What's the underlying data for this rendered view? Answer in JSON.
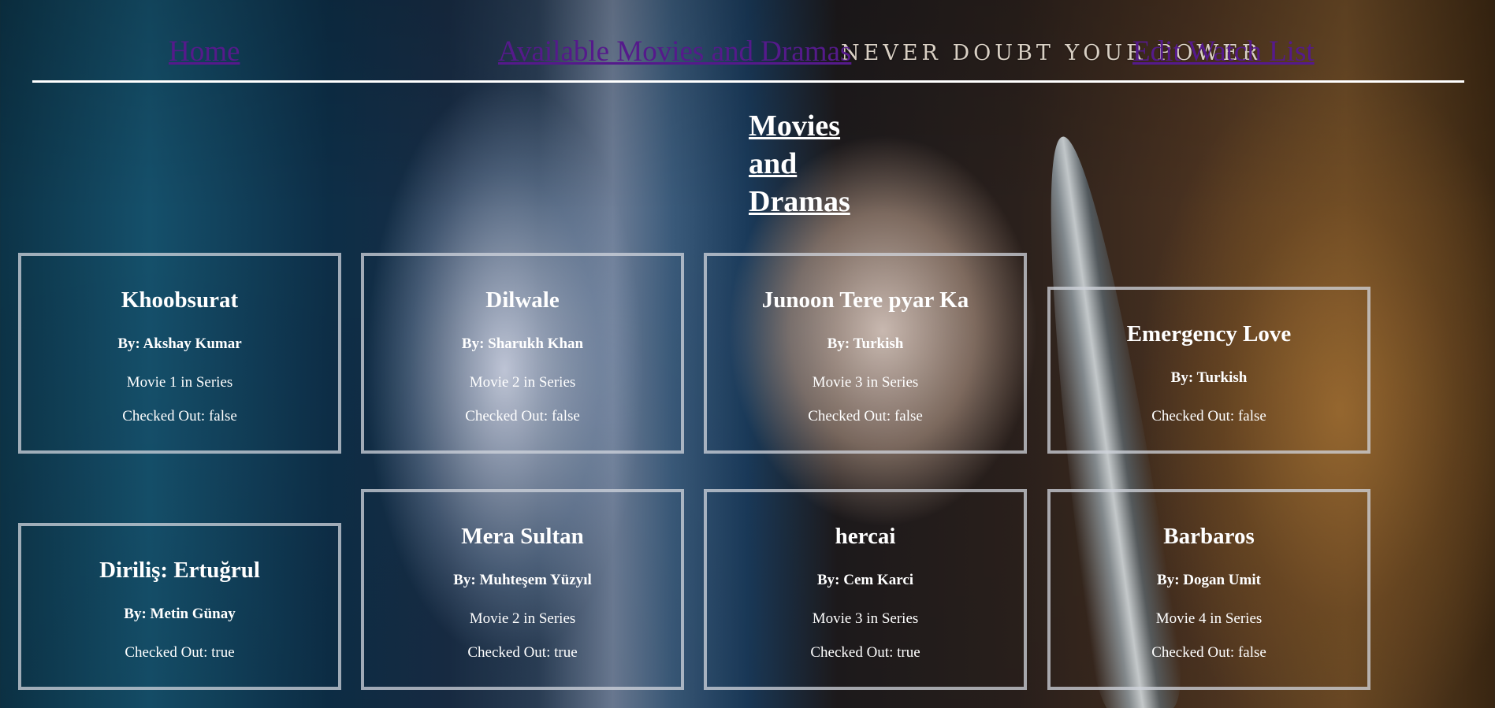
{
  "background": {
    "tagline": "NEVER DOUBT YOUR POWER"
  },
  "nav": {
    "home": "Home",
    "available": "Available Movies and Dramas",
    "edit": "Edit Watch List",
    "link_color": "#551a8b"
  },
  "page_title": "Movies and Dramas",
  "cards": [
    {
      "title": "Khoobsurat",
      "author": "By: Akshay Kumar",
      "series": "Movie 1 in Series",
      "checked_out": "Checked Out: false"
    },
    {
      "title": "Dilwale",
      "author": "By: Sharukh Khan",
      "series": "Movie 2 in Series",
      "checked_out": "Checked Out: false"
    },
    {
      "title": "Junoon Tere pyar Ka",
      "author": "By: Turkish",
      "series": "Movie 3 in Series",
      "checked_out": "Checked Out: false"
    },
    {
      "title": "Emergency Love",
      "author": "By: Turkish",
      "checked_out": "Checked Out: false"
    },
    {
      "title": "Diriliş: Ertuğrul",
      "author": "By: Metin Günay",
      "checked_out": "Checked Out: true"
    },
    {
      "title": "Mera Sultan",
      "author": "By: Muhteşem Yüzyıl",
      "series": "Movie 2 in Series",
      "checked_out": "Checked Out: true"
    },
    {
      "title": "hercai",
      "author": "By: Cem Karci",
      "series": "Movie 3 in Series",
      "checked_out": "Checked Out: true"
    },
    {
      "title": "Barbaros",
      "author": "By: Dogan Umit",
      "series": "Movie 4 in Series",
      "checked_out": "Checked Out: false"
    }
  ]
}
